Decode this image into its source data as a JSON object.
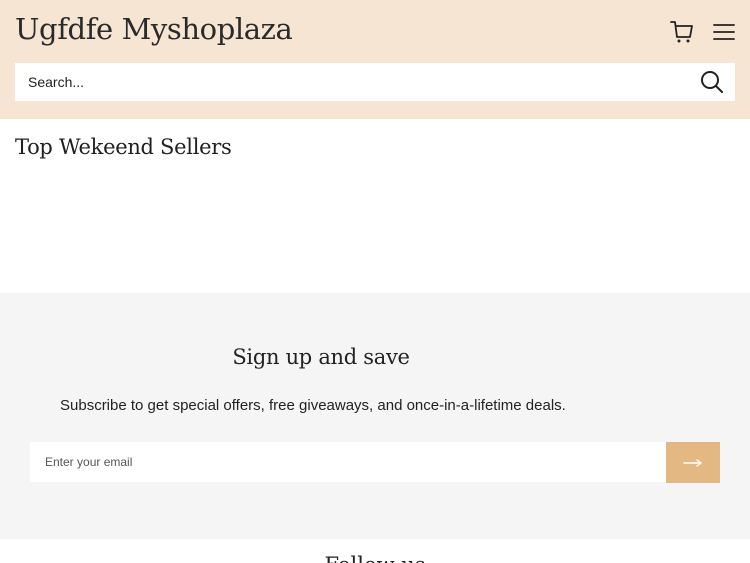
{
  "header": {
    "brand": "Ugfdfe Myshoplaza",
    "cart_icon": "cart-icon",
    "menu_icon": "hamburger-menu-icon"
  },
  "search": {
    "placeholder": "Search...",
    "icon": "search-icon"
  },
  "featured": {
    "title": "Top Wekeend Sellers"
  },
  "newsletter": {
    "title": "Sign up and save",
    "subtitle": "Subscribe to get special offers, free giveaways, and once-in-a-lifetime deals.",
    "email_placeholder": "Enter your email",
    "submit_icon": "arrow-right-icon"
  },
  "footer": {
    "partial_title": "Follow us"
  },
  "colors": {
    "header_bg": "#f6e5d3",
    "accent": "#e3b883",
    "newsletter_bg": "#f5f5f5"
  }
}
